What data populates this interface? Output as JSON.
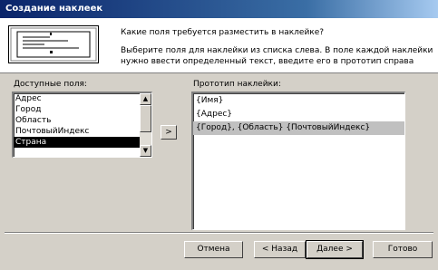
{
  "window": {
    "title": "Создание наклеек"
  },
  "header": {
    "question": "Какие поля требуется разместить в наклейке?",
    "description": "Выберите поля для наклейки из списка слева. В поле каждой наклейки нужно ввести определенный текст, введите его в прототип справа"
  },
  "available_fields": {
    "label": "Доступные поля:",
    "items": [
      "Адрес",
      "Город",
      "Область",
      "ПочтовыйИндекс",
      "Страна"
    ],
    "selected": "Страна"
  },
  "prototype": {
    "label": "Прототип наклейки:",
    "lines": [
      "{Имя}",
      "{Адрес}",
      "{Город}, {Область} {ПочтовыйИндекс}"
    ],
    "selected_line": "{Город}, {Область} {ПочтовыйИндекс}"
  },
  "add_button": {
    "label": ">"
  },
  "buttons": {
    "cancel": "Отмена",
    "back": "< Назад",
    "next": "Далее >",
    "finish": "Готово"
  }
}
